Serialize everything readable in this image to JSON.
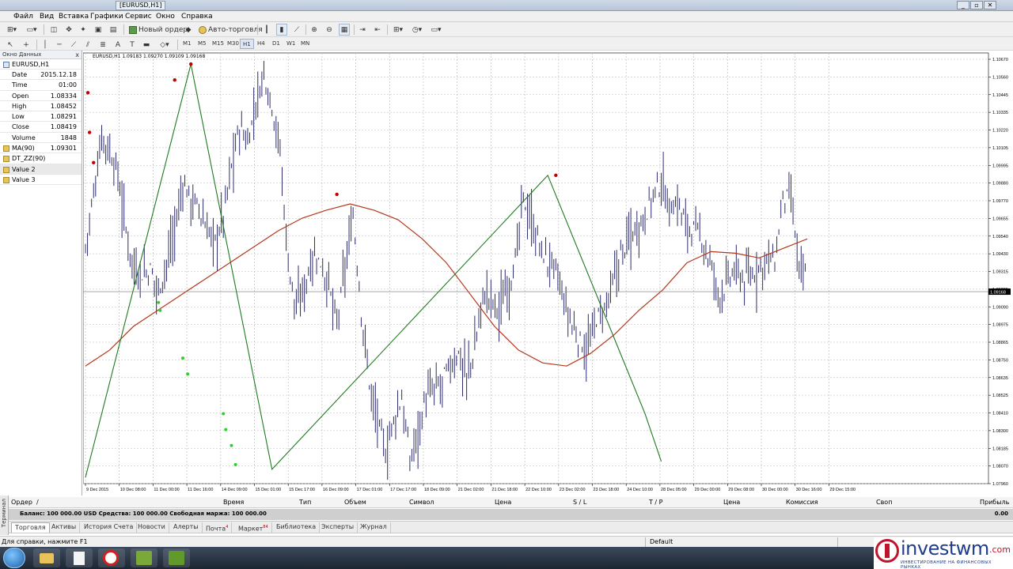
{
  "window": {
    "title": "[EURUSD,H1]",
    "min": "_",
    "restore": "▫",
    "close": "✕"
  },
  "menu": [
    "Файл",
    "Вид",
    "Вставка",
    "Графики",
    "Сервис",
    "Окно",
    "Справка"
  ],
  "toolbar": {
    "new_order": "Новый ордер",
    "auto_trading": "Авто-торговля",
    "search_icon": "⌕"
  },
  "timeframes": [
    "M1",
    "M5",
    "M15",
    "M30",
    "H1",
    "H4",
    "D1",
    "W1",
    "MN"
  ],
  "active_timeframe": "H1",
  "data_window": {
    "title": "Окно Данных",
    "close": "x",
    "symbol": "EURUSD,H1",
    "rows": [
      {
        "k": "Date",
        "v": "2015.12.18"
      },
      {
        "k": "Time",
        "v": "01:00"
      },
      {
        "k": "Open",
        "v": "1.08334"
      },
      {
        "k": "High",
        "v": "1.08452"
      },
      {
        "k": "Low",
        "v": "1.08291"
      },
      {
        "k": "Close",
        "v": "1.08419"
      },
      {
        "k": "Volume",
        "v": "1848"
      }
    ],
    "indicators": [
      {
        "k": "MA(90)",
        "v": "1.09301"
      },
      {
        "k": "DT_ZZ(90)",
        "v": ""
      },
      {
        "k": "Value 2",
        "v": ""
      },
      {
        "k": "Value 3",
        "v": ""
      }
    ]
  },
  "chart_data": {
    "type": "candlestick",
    "symbol_label": "EURUSD,H1  1.09183 1.09270 1.09109 1.09168",
    "current_price": "1.09168",
    "y_ticks": [
      "1.10670",
      "1.10560",
      "1.10445",
      "1.10335",
      "1.10220",
      "1.10105",
      "1.09995",
      "1.09880",
      "1.09770",
      "1.09655",
      "1.09540",
      "1.09430",
      "1.09315",
      "1.09205",
      "1.09090",
      "1.08975",
      "1.08865",
      "1.08750",
      "1.08635",
      "1.08525",
      "1.08410",
      "1.08300",
      "1.08185",
      "1.08070",
      "1.07960"
    ],
    "y_range": [
      1.0796,
      1.1067
    ],
    "x_ticks": [
      "9 Dec 2015",
      "10 Dec 08:00",
      "11 Dec 00:00",
      "11 Dec 16:00",
      "14 Dec 09:00",
      "15 Dec 01:00",
      "15 Dec 17:00",
      "16 Dec 09:00",
      "17 Dec 01:00",
      "17 Dec 17:00",
      "18 Dec 09:00",
      "21 Dec 02:00",
      "21 Dec 18:00",
      "22 Dec 10:00",
      "23 Dec 02:00",
      "23 Dec 18:00",
      "24 Dec 10:00",
      "28 Dec 05:00",
      "29 Dec 00:00",
      "29 Dec 08:00",
      "30 Dec 00:00",
      "30 Dec 16:00",
      "29 Dec 15:00"
    ],
    "close_series": [
      1.0945,
      1.0978,
      1.1015,
      1.1005,
      1.099,
      1.0955,
      1.0932,
      1.0928,
      1.093,
      1.0918,
      1.0935,
      1.0955,
      1.0985,
      1.0975,
      1.0968,
      1.0955,
      1.0948,
      1.0965,
      1.0995,
      1.102,
      1.101,
      1.1035,
      1.1055,
      1.1035,
      1.1005,
      1.0935,
      1.0905,
      1.092,
      1.094,
      1.0935,
      1.092,
      1.0895,
      1.093,
      1.0965,
      1.0905,
      1.086,
      1.0835,
      1.0815,
      1.0835,
      1.085,
      1.081,
      1.083,
      1.085,
      1.0855,
      1.086,
      1.087,
      1.0878,
      1.0862,
      1.088,
      1.0915,
      1.0912,
      1.0905,
      1.092,
      1.0935,
      1.0975,
      1.096,
      1.0945,
      1.0935,
      1.093,
      1.091,
      1.0895,
      1.0885,
      1.088,
      1.09,
      1.0905,
      1.092,
      1.094,
      1.095,
      1.0958,
      1.0965,
      1.0978,
      1.0985,
      1.097,
      1.0972,
      1.096,
      1.0955,
      1.095,
      1.0935,
      1.0915,
      1.092,
      1.093,
      1.0925,
      1.0925,
      1.0932,
      1.0938,
      1.0935,
      1.0975,
      1.0975,
      1.093,
      1.0925
    ],
    "ma_series": [
      1.087,
      1.088,
      1.0895,
      1.0905,
      1.0915,
      1.0925,
      1.0935,
      1.0945,
      1.0955,
      1.0963,
      1.0968,
      1.0972,
      1.0968,
      1.0962,
      1.095,
      1.0935,
      1.0915,
      1.0895,
      1.088,
      1.0872,
      1.087,
      1.0878,
      1.089,
      1.0905,
      1.0918,
      1.0935,
      1.0942,
      1.0941,
      1.0938,
      1.0944,
      1.095
    ],
    "zigzag": [
      [
        0,
        1.08
      ],
      [
        13,
        1.106
      ],
      [
        23,
        1.0805
      ],
      [
        57,
        1.099
      ],
      [
        69,
        1.084
      ],
      [
        71,
        1.081
      ]
    ],
    "red_markers": [
      [
        0.3,
        1.1042
      ],
      [
        0.5,
        1.1017
      ],
      [
        1.0,
        1.0998
      ],
      [
        11,
        1.105
      ],
      [
        13,
        1.106
      ],
      [
        31,
        1.0978
      ],
      [
        58,
        1.099
      ]
    ],
    "green_markers": [
      [
        9,
        1.091
      ],
      [
        9.2,
        1.0905
      ],
      [
        12,
        1.0875
      ],
      [
        12.6,
        1.0865
      ],
      [
        17,
        1.084
      ],
      [
        17.3,
        1.083
      ],
      [
        18,
        1.082
      ],
      [
        18.5,
        1.0808
      ]
    ],
    "colors": {
      "candle": "#2c2c6e",
      "ma": "#b5361b",
      "zigzag": "#1f7a1f",
      "grid": "#b8b8b8",
      "marker_red": "#c00000",
      "marker_green": "#33cc33"
    }
  },
  "terminal": {
    "side_label": "Терминал",
    "columns": [
      "Ордер",
      "/",
      "Время",
      "Тип",
      "Объем",
      "Символ",
      "Цена",
      "S / L",
      "T / P",
      "Цена",
      "Комиссия",
      "Своп",
      "Прибыль"
    ],
    "balance_text": "Баланс: 100 000.00 USD  Средства: 100 000.00  Свободная маржа: 100 000.00",
    "profit": "0.00",
    "tabs": [
      {
        "label": "Торговля",
        "badge": ""
      },
      {
        "label": "Активы",
        "badge": ""
      },
      {
        "label": "История Счета",
        "badge": ""
      },
      {
        "label": "Новости",
        "badge": ""
      },
      {
        "label": "Алерты",
        "badge": ""
      },
      {
        "label": "Почта",
        "badge": "4"
      },
      {
        "label": "Маркет",
        "badge": "84"
      },
      {
        "label": "Библиотека",
        "badge": ""
      },
      {
        "label": "Эксперты",
        "badge": ""
      },
      {
        "label": "Журнал",
        "badge": ""
      }
    ]
  },
  "status": {
    "help": "Для справки, нажмите F1",
    "profile": "Default"
  },
  "watermark": {
    "brand": "investwm",
    "brand_tld": ".com",
    "tagline": "ИНВЕСТИРОВАНИЕ НА ФИНАНСОВЫХ РЫНКАХ"
  }
}
